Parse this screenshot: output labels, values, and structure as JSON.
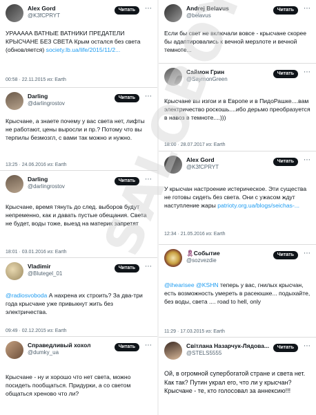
{
  "follow_label": "Читать",
  "watermark": "SALOBOY",
  "left": {
    "t1": {
      "name": "Alex Gord",
      "handle": "@K3fCPRYT",
      "text_a": "УРААААА ВАТНЫЕ ВАТНИКИ ПРЕДАТЕЛИ КРЫСЧАНЕ БЕЗ СВЕТА",
      "text_b": " Крым остался без света (обновляется) ",
      "link": "society.lb.ua/life/2015/11/2...",
      "meta": "00:58 · 22.11.2015 из: Earth"
    },
    "t2": {
      "name": "Darling",
      "handle": "@darlingrostov",
      "text": "Крысчане, а знаете почему у вас света нет, лифты не работают, цены выросли и пр.? Потому что вы терпилы безмозгл, с вами так можно и нужно.",
      "meta": "13:25 · 24.06.2016 из: Earth"
    },
    "t3": {
      "name": "Darling",
      "handle": "@darlingrostov",
      "text": "Крысчане, время тянуть до след. выборов будут непременно, как и давать пустые обещания. Света не будет, воды тоже, выезд на материк запретят",
      "meta": "18:01 · 03.01.2016 из: Earth"
    },
    "t4": {
      "name": "Vladimir",
      "handle": "@Blutegel_01",
      "mention": "@radiosvoboda",
      "text": " А нахрена их строить? За два-три года крысчане уже привыкнут жить без электричества.",
      "meta": "09:49 · 02.12.2015 из: Earth"
    },
    "t5": {
      "name": "Справедливый хохол",
      "handle": "@dumky_ua",
      "text": "Крысчане - ну и хорошо что нет света, можно посидеть пообщаться. Придурки, а со светом общаться хреново что ли?"
    }
  },
  "right": {
    "t1": {
      "name": "Andrej Belavus",
      "handle": "@belavus",
      "text": "Если бы свет не включали вовсе - крысчане скорее бы адаптировались к вечной мерзлоте и вечной темноте..."
    },
    "t2": {
      "name": "Саймон Грин",
      "handle": "@SaymonGreen",
      "text": "Крысчане вы изгои и в Европе и в ПидоРашке....вам электричество роскошь....ибо дерьмо преобразуется в навоз в темноте....)))",
      "meta": "18:00 · 28.07.2017 из: Earth"
    },
    "t3": {
      "name": "Alex Gord",
      "handle": "@K3fCPRYT",
      "text": "У крысчан настроение истерическое. Эти существа не готовы сидеть без света. Они с ужасом ждут наступление жары ",
      "link": "patrioty.org.ua/blogs/seichas-...",
      "meta": "12:34 · 21.05.2016 из: Earth"
    },
    "t4": {
      "name": "Событие",
      "handle": "@sozvezdie",
      "mention1": "@ihearisee",
      "mention2": "@KSHN",
      "text": " теперь у вас, гнилых крысчан, есть возможность умереть в расеюшке... подыхайте, без воды, света .... road to hell, only",
      "meta": "11:29 · 17.03.2015 из: Earth"
    },
    "t5": {
      "name": "Світлана Назарчук-Лядова...",
      "handle": "@STELS5555",
      "text": "Ой, в огромной супербогатой стране и света нет. Как так? Путин украл его, что ли у крысчан? Крысчане - те, кто голосовал за аннексию!!!"
    }
  }
}
